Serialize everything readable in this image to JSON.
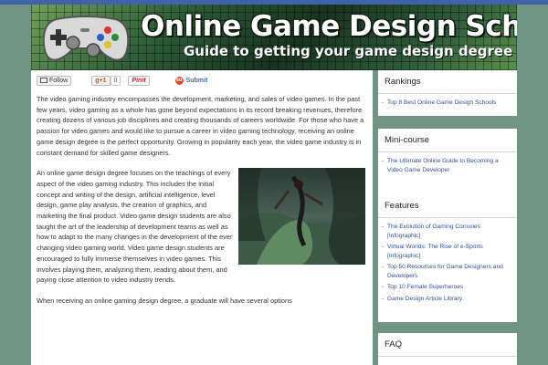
{
  "header": {
    "title": "Online Game Design Schools",
    "subtitle": "Guide to getting your game design degree online",
    "logo_icon": "gamepad-icon"
  },
  "share_bar": {
    "follow_label": "Follow",
    "gplus_label": "g+1",
    "gplus_count": "0",
    "pinit_label": "Pinit",
    "submit_label": "Submit",
    "stumble_icon": "su"
  },
  "article": {
    "p1": "The video gaming industry encompasses the development, marketing, and sales of video games. In the past few years, video gaming as a whole has gone beyond expectations in its record breaking revenues, therefore creating dozens of various job disciplines and creating thousands of careers worldwide. For those who have a passion for video games and would like to pursue a career in video gaming technology, receiving an online game design degree is the perfect opportunity. Growing in popularity each year, the video game industry is in constant demand for skilled game designers.",
    "p2": "An online game design degree focuses on the teachings of every aspect of the video gaming industry. This includes the initial concept and writing of the design, artificial intelligence, level design, game play analysis, the creation of graphics, and marketing the final product. Video game design students are also taught the art of the leadership of development teams as well as how to adapt to the many changes in the development of the ever changing video gaming world. Video game design students are encouraged to fully immerse themselves in video games. This involves playing them, analyzing them, reading about them, and paying close attention to video industry trends.",
    "p3": "When receiving an online gaming design degree, a graduate will have several options"
  },
  "sidebar": {
    "rankings": {
      "title": "Rankings",
      "items": [
        "Top 8 Best Online Game Design Schools"
      ]
    },
    "minicourse": {
      "title": "Mini-course",
      "items": [
        "The Ultimate Online Guide to Becoming a Video Game Developer"
      ]
    },
    "features": {
      "title": "Features",
      "items": [
        "The Evolution of Gaming Consoles [Infographic]",
        "Virtual Worlds: The Rise of e-Sports [Infographic]",
        "Top 50 Resources for Game Designers and Developers",
        "Top 10 Female Superheroes",
        "Game Design Article Library"
      ]
    },
    "faq": {
      "title": "FAQ"
    }
  }
}
